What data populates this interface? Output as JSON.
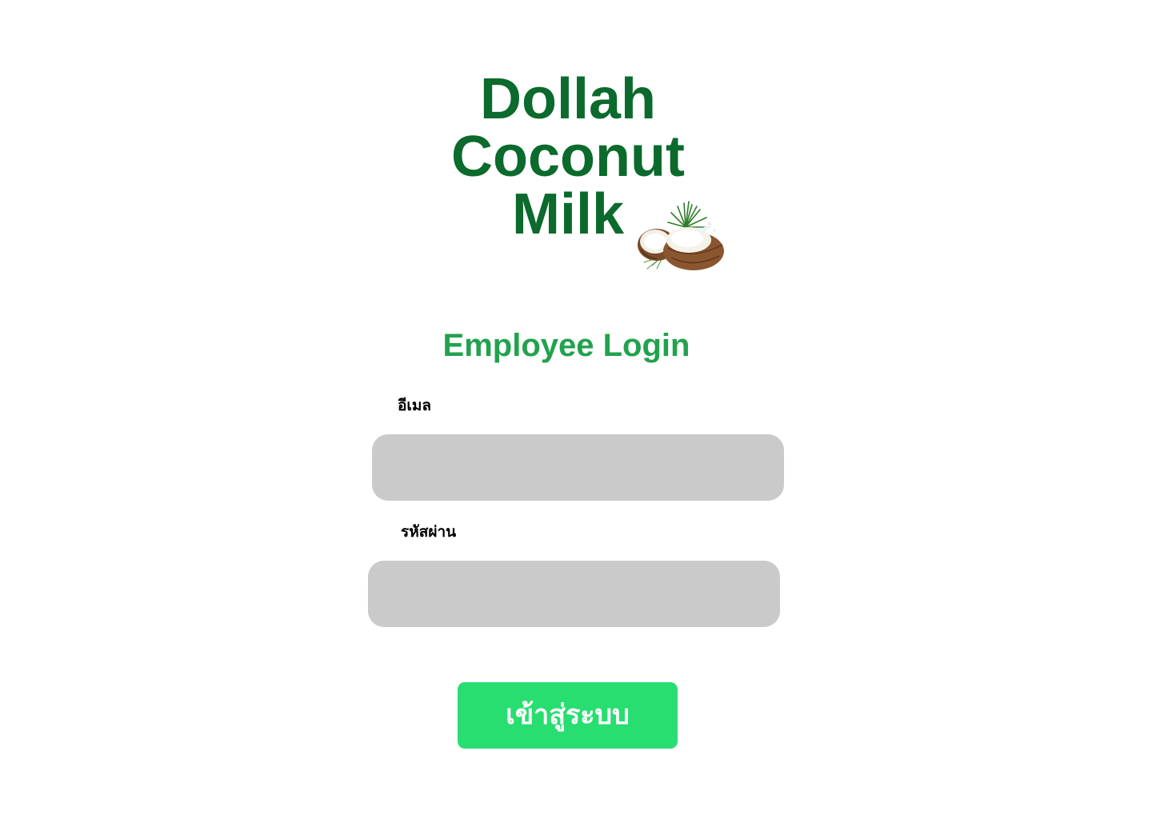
{
  "brand": {
    "title_lines": [
      "Dollah",
      "Coconut",
      "Milk"
    ],
    "image_icon": "coconut-icon"
  },
  "login": {
    "heading": "Employee Login",
    "email_label": "อีเมล",
    "email_value": "",
    "password_label": "รหัสผ่าน",
    "password_value": "",
    "submit_label": "เข้าสู่ระบบ"
  },
  "colors": {
    "brand_dark_green": "#0b6a2c",
    "heading_green": "#22a24d",
    "field_gray": "#cacaca",
    "button_green": "#28de71",
    "background": "#ffffff"
  }
}
